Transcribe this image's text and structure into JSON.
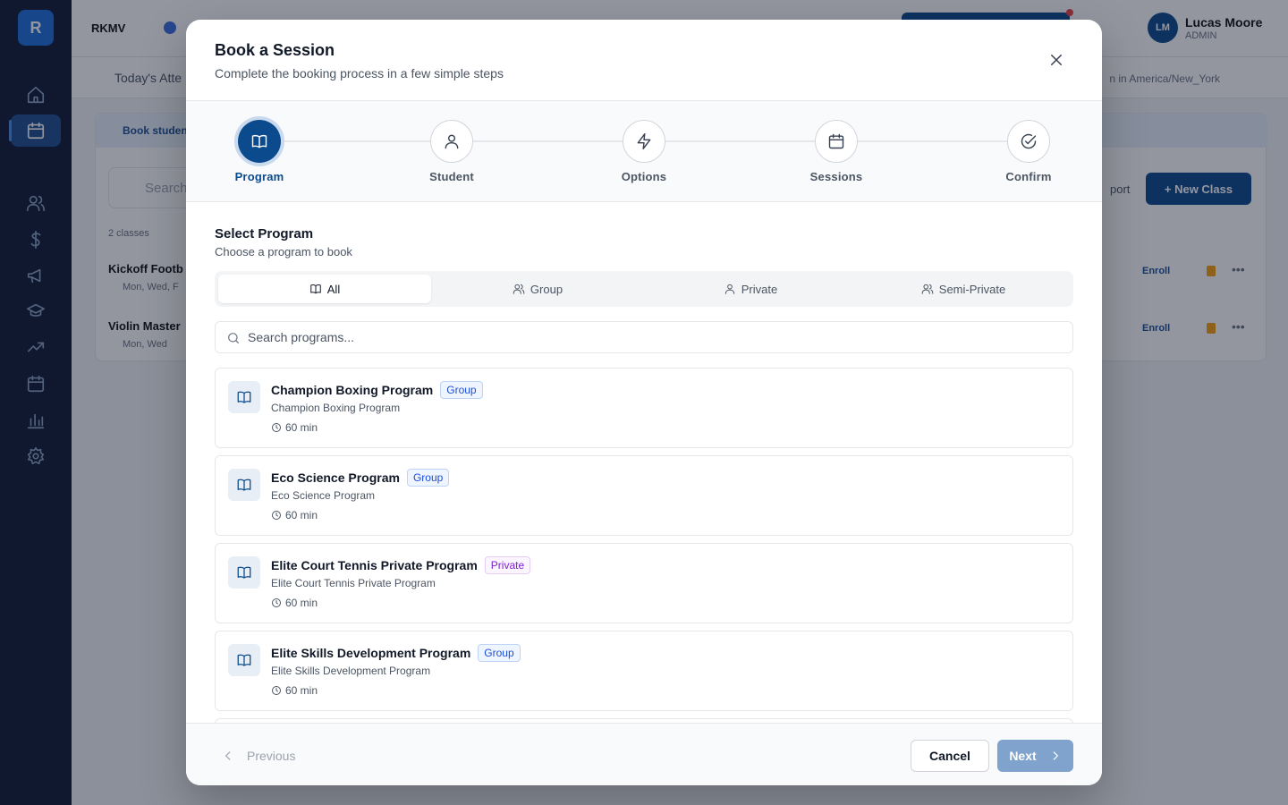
{
  "background": {
    "logo_letter": "R",
    "brand": "RKMV",
    "user_initials": "LM",
    "user_name": "Lucas Moore",
    "user_role": "ADMIN",
    "subbar_left": "Today's Atte",
    "subbar_right": "n in America/New_York",
    "book_strip": "Book studen",
    "search_placeholder": "Search",
    "report_label": "port",
    "new_class_label": "+ New Class",
    "class_count": "2 classes",
    "rows": [
      {
        "name": "Kickoff Footb",
        "days": "Mon, Wed, F",
        "enroll": "Enroll"
      },
      {
        "name": "Violin Master",
        "days": "Mon, Wed",
        "enroll": "Enroll"
      }
    ],
    "nav_icons": [
      "home-icon",
      "calendar-icon",
      "book-icon",
      "users-icon",
      "dollar-icon",
      "megaphone-icon",
      "graduation-icon",
      "trend-icon",
      "calendar-check-icon",
      "bar-chart-icon",
      "settings-icon"
    ]
  },
  "modal": {
    "title": "Book a Session",
    "subtitle": "Complete the booking process in a few simple steps",
    "steps": [
      {
        "label": "Program",
        "icon": "book-open-icon",
        "active": true
      },
      {
        "label": "Student",
        "icon": "user-icon",
        "active": false
      },
      {
        "label": "Options",
        "icon": "zap-icon",
        "active": false
      },
      {
        "label": "Sessions",
        "icon": "calendar-icon",
        "active": false
      },
      {
        "label": "Confirm",
        "icon": "check-circle-icon",
        "active": false
      }
    ],
    "section_title": "Select Program",
    "section_subtitle": "Choose a program to book",
    "filters": [
      {
        "label": "All",
        "icon": "book-open-icon",
        "active": true
      },
      {
        "label": "Group",
        "icon": "users-icon",
        "active": false
      },
      {
        "label": "Private",
        "icon": "user-icon",
        "active": false
      },
      {
        "label": "Semi-Private",
        "icon": "users-icon",
        "active": false
      }
    ],
    "search_placeholder": "Search programs...",
    "programs": [
      {
        "name": "Champion Boxing Program",
        "badge": "Group",
        "badge_type": "group",
        "description": "Champion Boxing Program",
        "duration": "60 min"
      },
      {
        "name": "Eco Science Program",
        "badge": "Group",
        "badge_type": "group",
        "description": "Eco Science Program",
        "duration": "60 min"
      },
      {
        "name": "Elite Court Tennis Private Program",
        "badge": "Private",
        "badge_type": "private",
        "description": "Elite Court Tennis Private Program",
        "duration": "60 min"
      },
      {
        "name": "Elite Skills Development Program",
        "badge": "Group",
        "badge_type": "group",
        "description": "Elite Skills Development Program",
        "duration": "60 min"
      },
      {
        "name": "",
        "badge": "",
        "badge_type": "group",
        "description": "",
        "duration": ""
      }
    ],
    "footer": {
      "previous_label": "Previous",
      "cancel_label": "Cancel",
      "next_label": "Next"
    }
  },
  "colors": {
    "primary": "#0b4a8c",
    "sidebar": "#0f1b33",
    "group_badge": "#1d4ed8",
    "private_badge": "#7e22ce",
    "next_disabled": "#7fa3cc"
  }
}
